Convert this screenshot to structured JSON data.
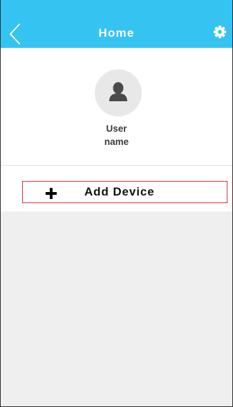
{
  "header": {
    "title": "Home",
    "back_icon": "chevron-left-icon",
    "settings_icon": "gear-icon",
    "background": "#35c3f1"
  },
  "profile": {
    "avatar_icon": "user-icon",
    "name_line1": "User",
    "name_line2": "name"
  },
  "add_device": {
    "icon": "plus-icon",
    "label": "Add Device",
    "border_color": "#e32c3a"
  },
  "device_list": {
    "background": "#efefef",
    "items": []
  }
}
